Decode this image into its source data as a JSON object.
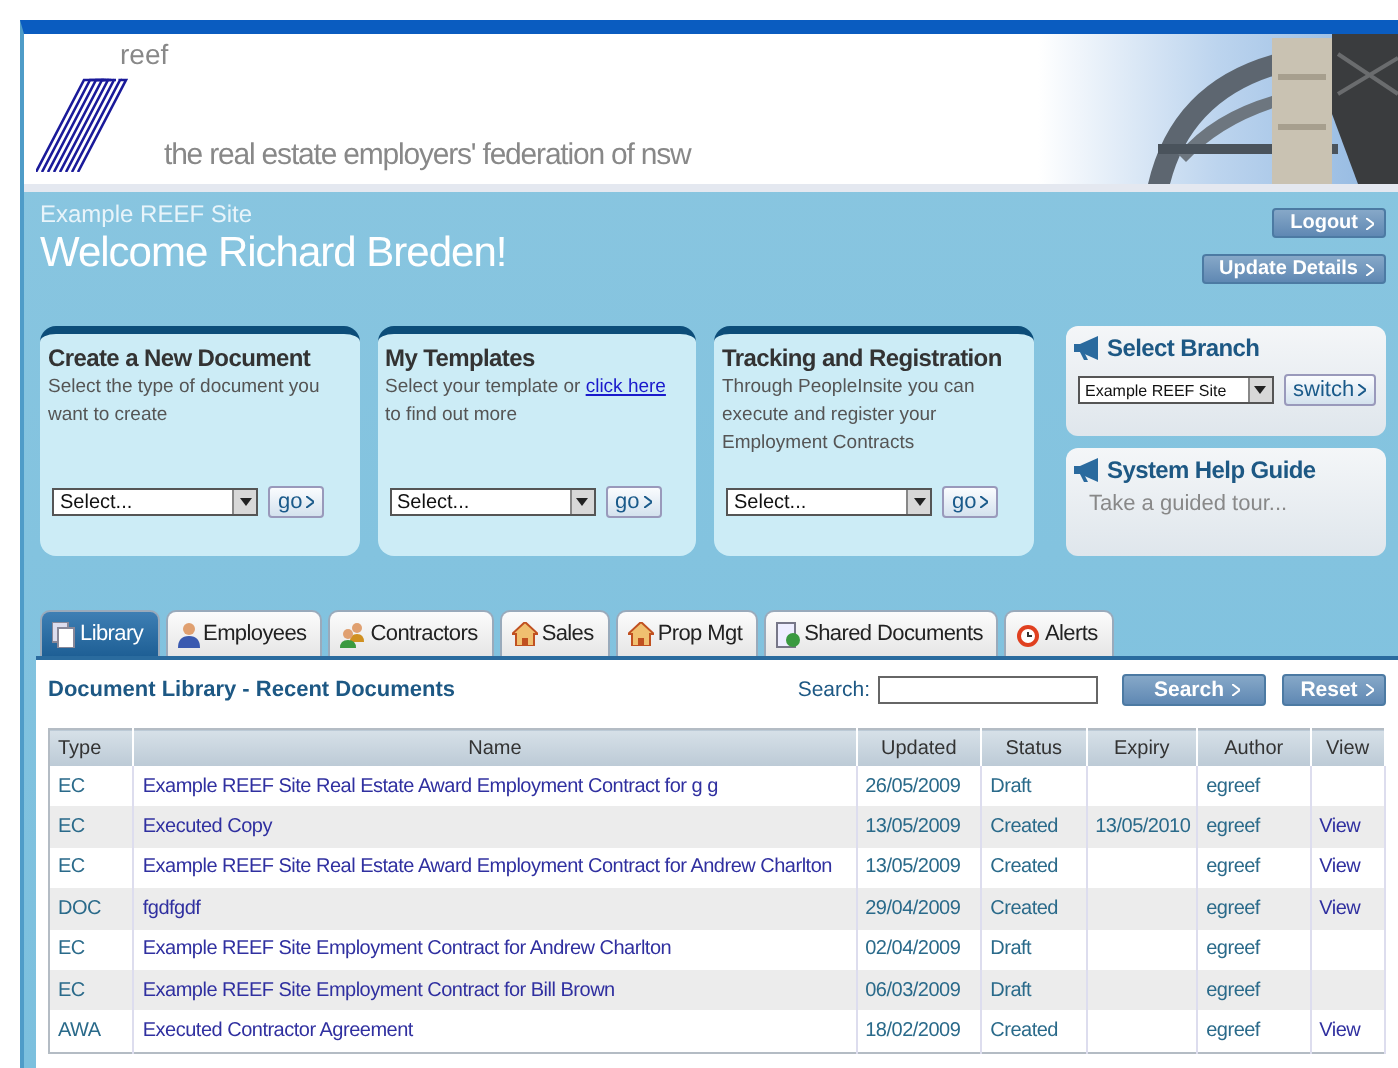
{
  "header": {
    "logo_text": "reef",
    "tagline": "the real estate employers' federation of nsw"
  },
  "site_name": "Example REEF Site",
  "welcome": "Welcome Richard Breden!",
  "account_buttons": [
    "Logout",
    "Update Details"
  ],
  "cards": [
    {
      "title": "Create a New Document",
      "description": "Select the type of document you want to create",
      "select": "Select...",
      "button": "go"
    },
    {
      "title": "My Templates",
      "description": "Select your template or",
      "link": "click here",
      "description_after": "to find out more",
      "select": "Select...",
      "button": "go"
    },
    {
      "title": "Tracking and Registration",
      "description": "Through PeopleInsite you can execute and register your Employment Contracts",
      "select": "Select...",
      "button": "go"
    }
  ],
  "branch": {
    "title": "Select Branch",
    "select": "Example REEF Site",
    "button": "switch"
  },
  "help": {
    "title": "System Help Guide",
    "text": "Take a guided tour..."
  },
  "tabs": [
    {
      "label": "Library",
      "kind": "documents",
      "selected": true
    },
    {
      "label": "Employees",
      "kind": "person",
      "selected": false
    },
    {
      "label": "Contractors",
      "kind": "people",
      "selected": false
    },
    {
      "label": "Sales",
      "kind": "house",
      "selected": false
    },
    {
      "label": "Prop Mgt",
      "kind": "house",
      "selected": false
    },
    {
      "label": "Shared Documents",
      "kind": "document",
      "selected": false
    },
    {
      "label": "Alerts",
      "kind": "alarm",
      "selected": false
    }
  ],
  "library": {
    "title": "Document Library - Recent Documents",
    "search_label": "Search:",
    "search_button": "Search",
    "reset_button": "Reset"
  },
  "table": {
    "columns": [
      "Type",
      "Name",
      "Updated",
      "Status",
      "Expiry",
      "Author",
      "View"
    ],
    "rows": [
      {
        "type": "EC",
        "name": "Example REEF Site Real Estate Award Employment Contract for g g",
        "updated": "26/05/2009",
        "status": "Draft",
        "author": "egreef"
      },
      {
        "type": "EC",
        "name": "Executed Copy",
        "updated": "13/05/2009",
        "status": "Created",
        "expiry": "13/05/2010",
        "author": "egreef",
        "view": "View"
      },
      {
        "type": "EC",
        "name": "Example REEF Site Real Estate Award Employment Contract for Andrew Charlton",
        "updated": "13/05/2009",
        "status": "Created",
        "author": "egreef",
        "view": "View"
      },
      {
        "type": "DOC",
        "name": "fgdfgdf",
        "updated": "29/04/2009",
        "status": "Created",
        "author": "egreef",
        "view": "View"
      },
      {
        "type": "EC",
        "name": "Example REEF Site Employment Contract for Andrew Charlton",
        "updated": "02/04/2009",
        "status": "Draft",
        "author": "egreef"
      },
      {
        "type": "EC",
        "name": "Example REEF Site Employment Contract for Bill Brown",
        "updated": "06/03/2009",
        "status": "Draft",
        "author": "egreef"
      },
      {
        "type": "AWA",
        "name": "Executed Contractor Agreement",
        "updated": "18/02/2009",
        "status": "Created",
        "author": "egreef",
        "view": "View"
      }
    ]
  }
}
